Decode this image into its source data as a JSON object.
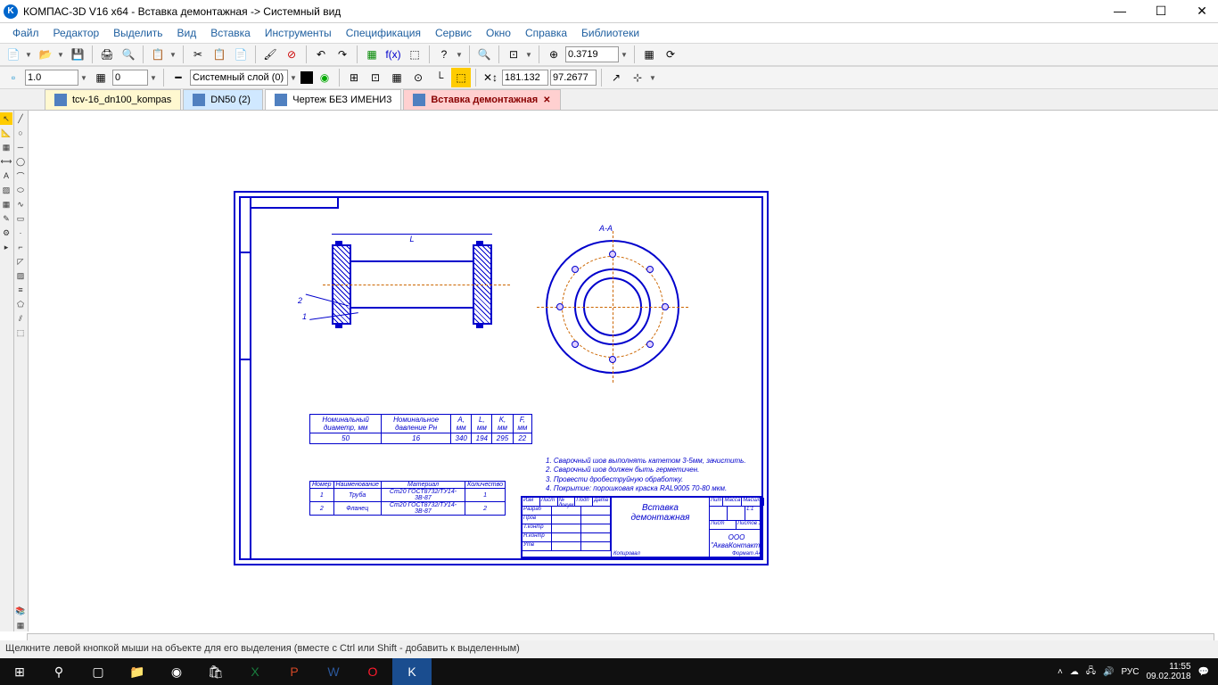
{
  "title": "КОМПАС-3D V16  x64 - Вставка демонтажная -> Системный вид",
  "menu": [
    "Файл",
    "Редактор",
    "Выделить",
    "Вид",
    "Вставка",
    "Инструменты",
    "Спецификация",
    "Сервис",
    "Окно",
    "Справка",
    "Библиотеки"
  ],
  "toolbar1": {
    "zoom": "0.3719"
  },
  "toolbar2": {
    "scale": "1.0",
    "step": "0",
    "layer": "Системный слой (0)",
    "x": "181.132",
    "y": "97.2677"
  },
  "tabs": [
    {
      "label": "tcv-16_dn100_kompas"
    },
    {
      "label": "DN50 (2)"
    },
    {
      "label": "Чертеж БЕЗ ИМЕНИ3"
    },
    {
      "label": "Вставка демонтажная",
      "active": true
    }
  ],
  "drawing": {
    "dim_L": "L",
    "section": "A-A",
    "leader1": "1",
    "leader2": "2",
    "spec_headers": [
      "Номинальный диаметр, мм",
      "Номинальное давление Pн",
      "A, мм",
      "L, мм",
      "K, мм",
      "F, мм"
    ],
    "spec_row": [
      "50",
      "16",
      "340",
      "194",
      "295",
      "22"
    ],
    "bom_headers": [
      "Номер",
      "Наименование",
      "Материал",
      "Количество"
    ],
    "bom_rows": [
      [
        "1",
        "Труба",
        "Ст20 ГОСТ8732/ТУ14-3В-87",
        "1"
      ],
      [
        "2",
        "Фланец",
        "Ст20 ГОСТ8732/ТУ14-3В-87",
        "2"
      ]
    ],
    "notes": [
      "1. Сварочный шов выполнять катетом 3-5мм, зачистить.",
      "2. Сварочный шов должен быть герметичен.",
      "3. Провести дробеструйную обработку.",
      "4. Покрытие: порошковая краска RAL9005 70-80 мкм."
    ],
    "titleblock": {
      "main": "Вставка демонтажная",
      "company": "ООО \"АкваКонтакт\"",
      "mass": "1:1",
      "format": "Формат   А4",
      "copied": "Копировал"
    }
  },
  "statusbar": "Щелкните левой кнопкой мыши на объекте для его выделения (вместе с Ctrl или Shift - добавить к выделенным)",
  "taskbar": {
    "lang": "РУС",
    "time": "11:55",
    "date": "09.02.2018"
  }
}
